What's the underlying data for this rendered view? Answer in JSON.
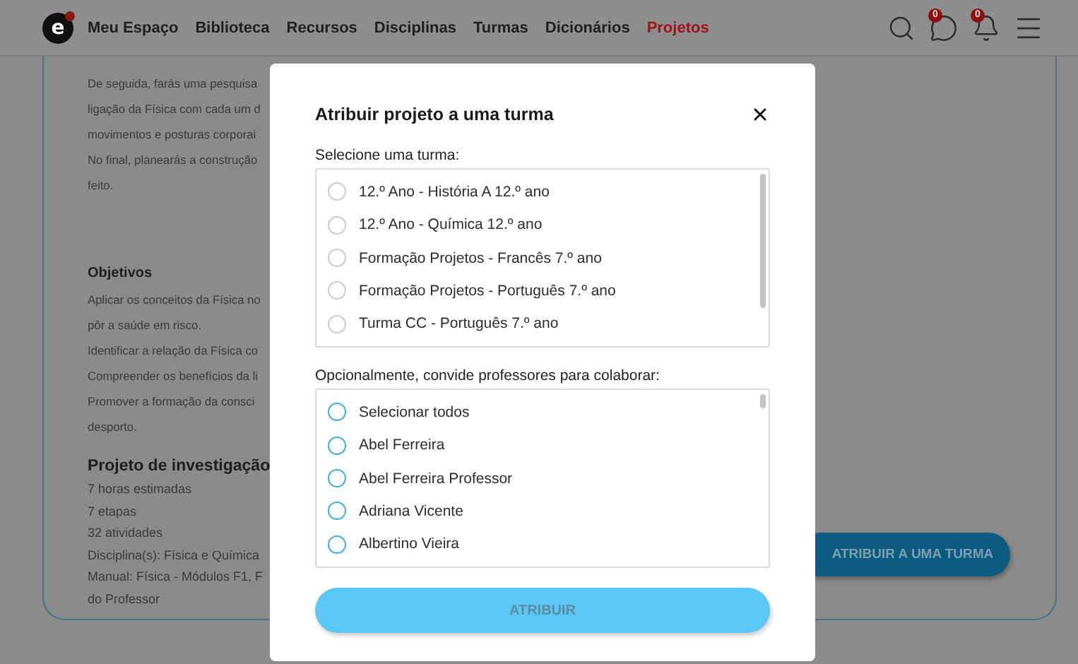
{
  "header": {
    "logo": "e",
    "nav": [
      {
        "label": "Meu Espaço",
        "selected": false
      },
      {
        "label": "Biblioteca",
        "selected": false
      },
      {
        "label": "Recursos",
        "selected": false
      },
      {
        "label": "Disciplinas",
        "selected": false
      },
      {
        "label": "Turmas",
        "selected": false
      },
      {
        "label": "Dicionários",
        "selected": false
      },
      {
        "label": "Projetos",
        "selected": true
      }
    ],
    "messages_badge": "0",
    "notifications_badge": "0"
  },
  "project": {
    "intro_lines": [
      "De seguida, farás uma pesquisa",
      "ligação da Física com cada um d",
      "movimentos e posturas corporai",
      "No final, planearás a construção",
      "feito."
    ],
    "objectives_title": "Objetivos",
    "objectives_lines": [
      "Aplicar os conceitos da Física no",
      "pôr a saúde em risco.",
      "Identificar a relação da Física co",
      "Compreender os benefícios da li",
      "Promover a formação da consci",
      "desporto."
    ],
    "details_title": "Projeto de investigação",
    "details_lines": [
      "7 horas estimadas",
      "7 etapas",
      "32 atividades",
      "Disciplina(s): Física e Química",
      "Manual: Física - Módulos F1, F",
      "do Professor"
    ],
    "assign_button": "ATRIBUIR A UMA TURMA"
  },
  "dialog": {
    "title": "Atribuir projeto a uma turma",
    "class_label": "Selecione uma turma:",
    "classes": [
      {
        "label": "12.º Ano - História A 12.º ano",
        "selected": false
      },
      {
        "label": "12.º Ano - Química 12.º ano",
        "selected": false
      },
      {
        "label": "Formação Projetos - Francês 7.º ano",
        "selected": false
      },
      {
        "label": "Formação Projetos - Português 7.º ano",
        "selected": false
      },
      {
        "label": "Turma CC - Português 7.º ano",
        "selected": false
      }
    ],
    "teachers_label": "Opcionalmente, convide professores para colaborar:",
    "teachers": [
      {
        "label": "Selecionar todos",
        "checked": false
      },
      {
        "label": "Abel Ferreira",
        "checked": false
      },
      {
        "label": "Abel Ferreira Professor",
        "checked": false
      },
      {
        "label": "Adriana Vicente",
        "checked": false
      },
      {
        "label": "Albertino Vieira",
        "checked": false
      }
    ],
    "submit_button": "ATRIBUIR"
  }
}
